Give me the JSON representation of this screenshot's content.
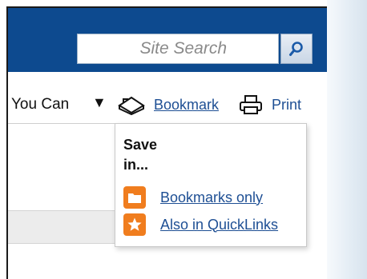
{
  "search": {
    "placeholder": "Site Search"
  },
  "toolbar": {
    "dropdown_label": "You Can",
    "dropdown_arrow": "▼",
    "bookmark_label": "Bookmark",
    "print_label": "Print"
  },
  "save_menu": {
    "title": "Save in...",
    "options": [
      {
        "label": "Bookmarks only",
        "icon": "folder-icon"
      },
      {
        "label": "Also in QuickLinks",
        "icon": "star-icon"
      }
    ]
  },
  "colors": {
    "header_blue": "#0d4a8f",
    "link_blue": "#1e4f94",
    "option_orange": "#f07d1e"
  }
}
